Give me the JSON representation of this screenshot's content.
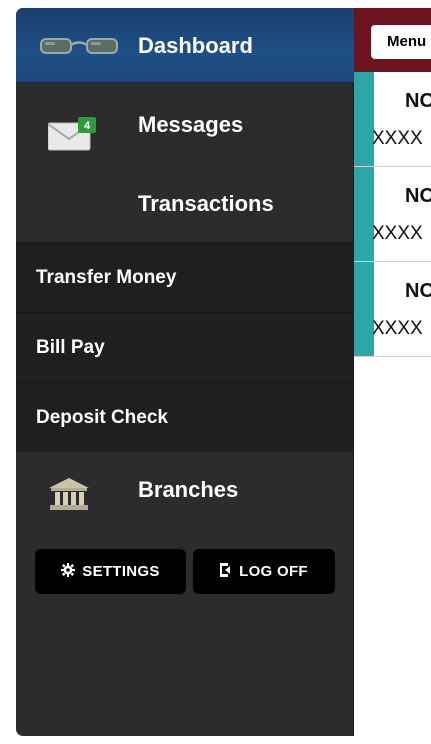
{
  "nav": {
    "dashboard": "Dashboard",
    "messages": "Messages",
    "messages_badge": "4",
    "transactions": "Transactions",
    "branches": "Branches"
  },
  "submenu": {
    "transfer": "Transfer Money",
    "billpay": "Bill Pay",
    "deposit": "Deposit Check"
  },
  "buttons": {
    "settings": "SETTINGS",
    "logoff": "LOG OFF"
  },
  "content": {
    "menu_label": "Menu",
    "accounts": [
      {
        "title": "NO",
        "number": "XXXX"
      },
      {
        "title": "NO",
        "number": "XXXX"
      },
      {
        "title": "NO",
        "number": "XXXX"
      }
    ]
  },
  "colors": {
    "drawer_bg": "#2c2c2e",
    "nav_active": "#1f4f86",
    "topbar": "#6b1420",
    "account_accent": "#2fa6a6",
    "badge": "#2e9b3a"
  },
  "icons": {
    "dashboard": "glasses-icon",
    "messages": "envelope-icon",
    "branches": "bank-icon",
    "settings": "gear-icon",
    "logoff": "logout-icon"
  }
}
